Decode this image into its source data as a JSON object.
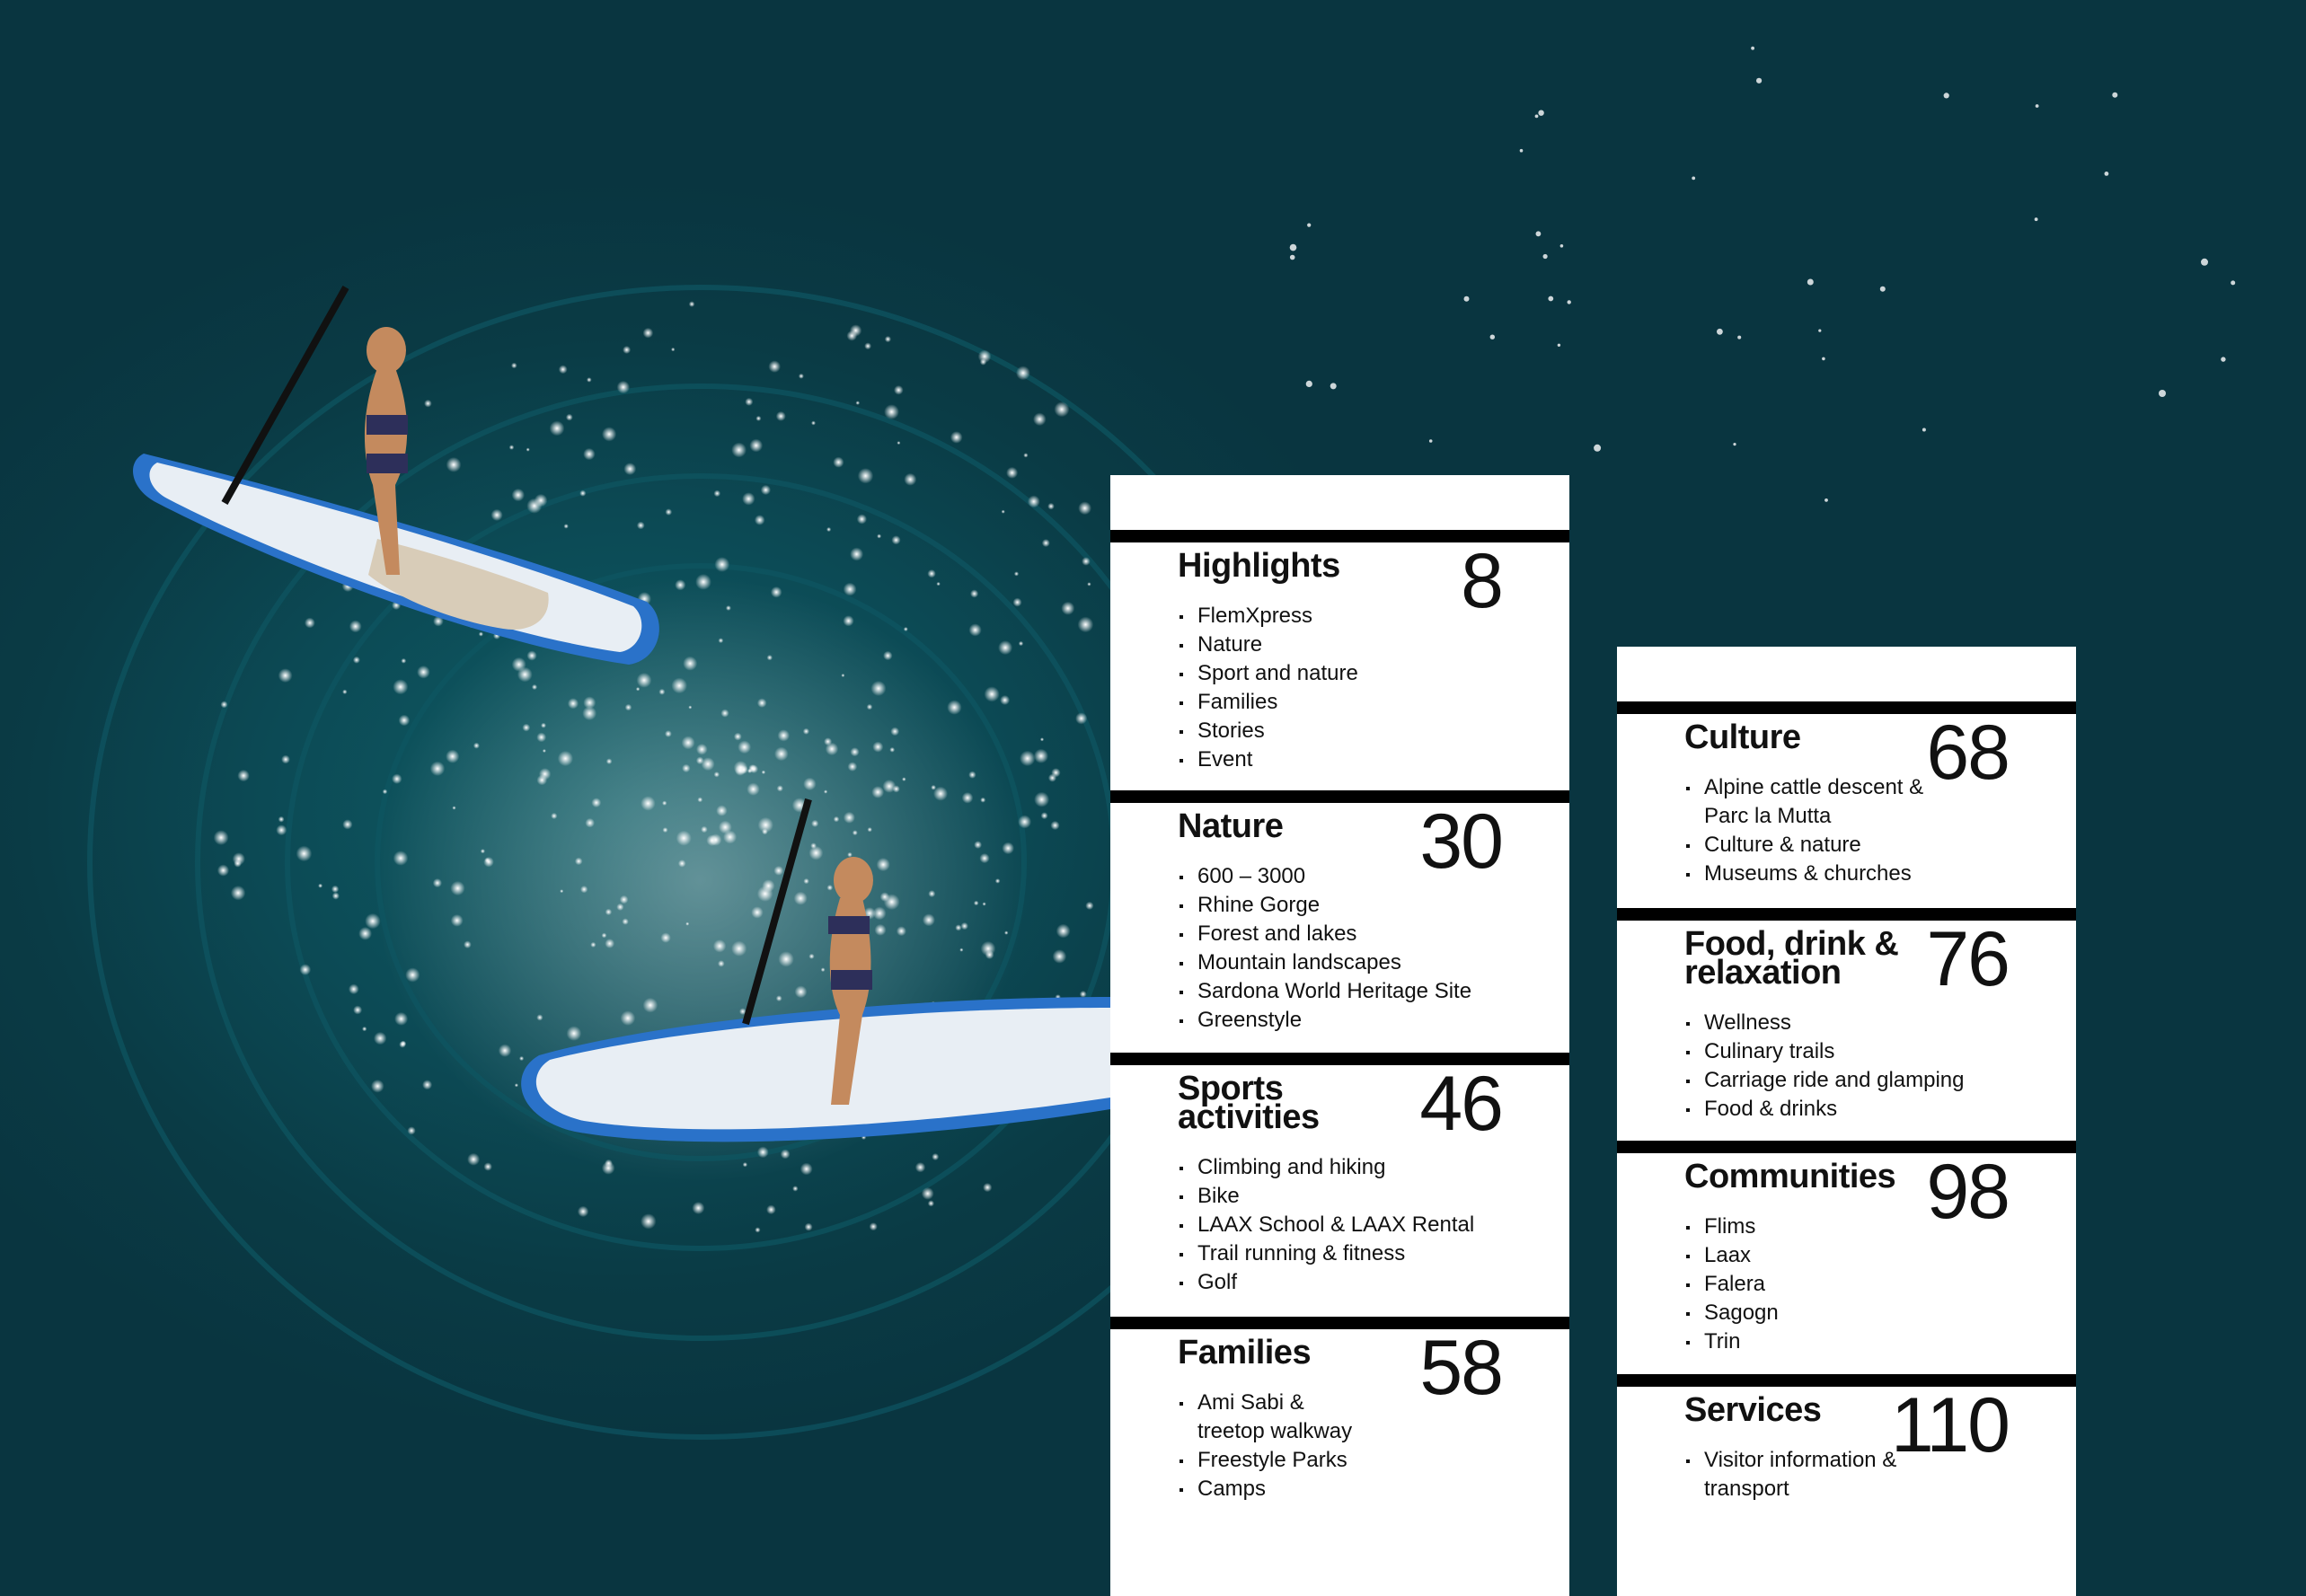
{
  "left_column": [
    {
      "title": "Highlights",
      "page": "8",
      "items": [
        "FlemXpress",
        "Nature",
        "Sport and nature",
        "Families",
        "Stories",
        "Event"
      ]
    },
    {
      "title": "Nature",
      "page": "30",
      "items": [
        "600 – 3000",
        "Rhine Gorge",
        "Forest and lakes",
        "Mountain landscapes",
        "Sardona World Heritage Site",
        "Greenstyle"
      ]
    },
    {
      "title": "Sports activities",
      "page": "46",
      "items": [
        "Climbing and hiking",
        "Bike",
        "LAAX School & LAAX Rental",
        "Trail running & fitness",
        "Golf"
      ]
    },
    {
      "title": "Families",
      "page": "58",
      "items": [
        "Ami Sabi & treetop walkway",
        "Freestyle Parks",
        "Camps"
      ]
    }
  ],
  "right_column": [
    {
      "title": "Culture",
      "page": "68",
      "items": [
        "Alpine cattle descent & Parc la Mutta",
        "Culture & nature",
        "Museums & churches"
      ]
    },
    {
      "title": "Food, drink & relaxation",
      "page": "76",
      "items": [
        "Wellness",
        "Culinary trails",
        "Carriage ride and glamping",
        "Food & drinks"
      ]
    },
    {
      "title": "Communities",
      "page": "98",
      "items": [
        "Flims",
        "Laax",
        "Falera",
        "Sagogn",
        "Trin"
      ]
    },
    {
      "title": "Services",
      "page": "110",
      "items": [
        "Visitor information & transport"
      ]
    }
  ]
}
